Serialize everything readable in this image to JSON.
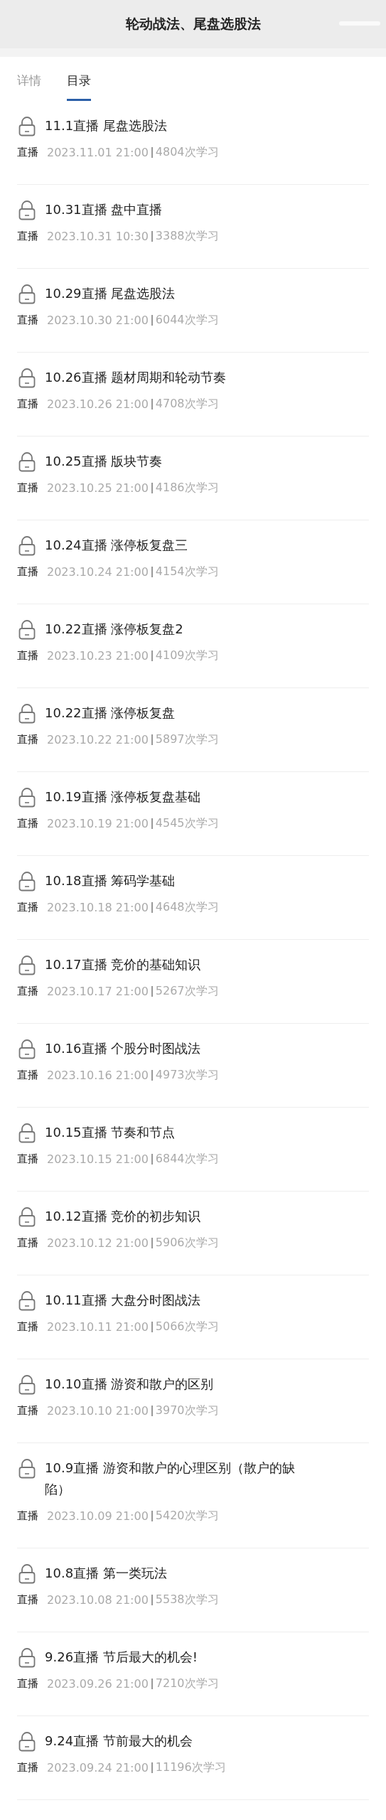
{
  "header": {
    "title": "轮动战法、尾盘选股法"
  },
  "tabs": [
    {
      "label": "详情",
      "selected": false
    },
    {
      "label": "目录",
      "selected": true
    }
  ],
  "lessons": [
    {
      "title": "11.1直播 尾盘选股法",
      "type": "直播",
      "time": "2023.11.01 21:00",
      "views": "4804次学习",
      "locked": true
    },
    {
      "title": "10.31直播 盘中直播",
      "type": "直播",
      "time": "2023.10.31 10:30",
      "views": "3388次学习",
      "locked": true
    },
    {
      "title": "10.29直播 尾盘选股法",
      "type": "直播",
      "time": "2023.10.30 21:00",
      "views": "6044次学习",
      "locked": true
    },
    {
      "title": "10.26直播 题材周期和轮动节奏",
      "type": "直播",
      "time": "2023.10.26 21:00",
      "views": "4708次学习",
      "locked": true
    },
    {
      "title": "10.25直播 版块节奏",
      "type": "直播",
      "time": "2023.10.25 21:00",
      "views": "4186次学习",
      "locked": true
    },
    {
      "title": "10.24直播 涨停板复盘三",
      "type": "直播",
      "time": "2023.10.24 21:00",
      "views": "4154次学习",
      "locked": true
    },
    {
      "title": "10.22直播 涨停板复盘2",
      "type": "直播",
      "time": "2023.10.23 21:00",
      "views": "4109次学习",
      "locked": true
    },
    {
      "title": "10.22直播 涨停板复盘",
      "type": "直播",
      "time": "2023.10.22 21:00",
      "views": "5897次学习",
      "locked": true
    },
    {
      "title": "10.19直播 涨停板复盘基础",
      "type": "直播",
      "time": "2023.10.19 21:00",
      "views": "4545次学习",
      "locked": true
    },
    {
      "title": "10.18直播 筹码学基础",
      "type": "直播",
      "time": "2023.10.18 21:00",
      "views": "4648次学习",
      "locked": true
    },
    {
      "title": "10.17直播 竞价的基础知识",
      "type": "直播",
      "time": "2023.10.17 21:00",
      "views": "5267次学习",
      "locked": true
    },
    {
      "title": "10.16直播 个股分时图战法",
      "type": "直播",
      "time": "2023.10.16 21:00",
      "views": "4973次学习",
      "locked": true
    },
    {
      "title": "10.15直播 节奏和节点",
      "type": "直播",
      "time": "2023.10.15 21:00",
      "views": "6844次学习",
      "locked": true
    },
    {
      "title": "10.12直播 竞价的初步知识",
      "type": "直播",
      "time": "2023.10.12 21:00",
      "views": "5906次学习",
      "locked": true
    },
    {
      "title": "10.11直播 大盘分时图战法",
      "type": "直播",
      "time": "2023.10.11 21:00",
      "views": "5066次学习",
      "locked": true
    },
    {
      "title": "10.10直播 游资和散户的区别",
      "type": "直播",
      "time": "2023.10.10 21:00",
      "views": "3970次学习",
      "locked": true
    },
    {
      "title": "10.9直播 游资和散户的心理区别（散户的缺陷）",
      "type": "直播",
      "time": "2023.10.09 21:00",
      "views": "5420次学习",
      "locked": true
    },
    {
      "title": "10.8直播 第一类玩法",
      "type": "直播",
      "time": "2023.10.08 21:00",
      "views": "5538次学习",
      "locked": true
    },
    {
      "title": "9.26直播 节后最大的机会!",
      "type": "直播",
      "time": "2023.09.26 21:00",
      "views": "7210次学习",
      "locked": true
    },
    {
      "title": "9.24直播 节前最大的机会",
      "type": "直播",
      "time": "2023.09.24 21:00",
      "views": "11196次学习",
      "locked": true
    }
  ]
}
